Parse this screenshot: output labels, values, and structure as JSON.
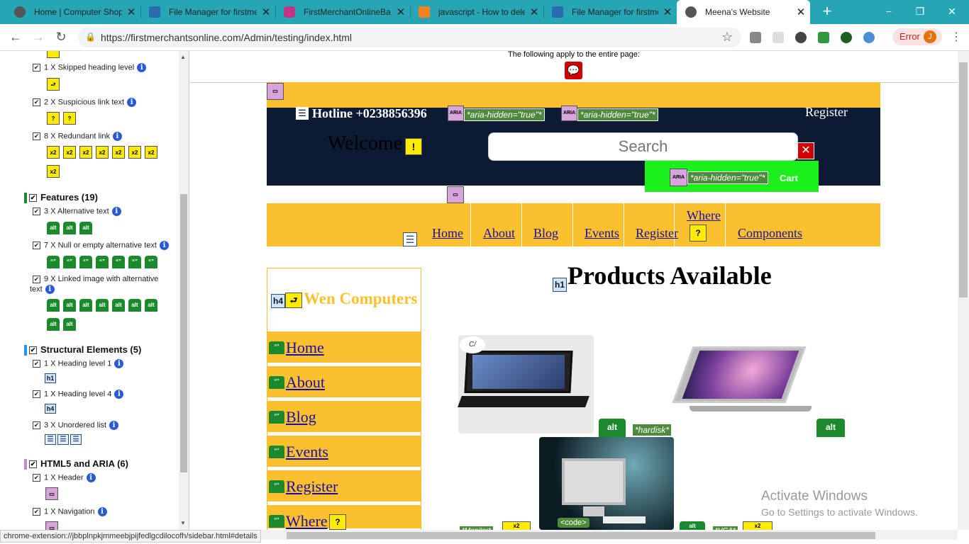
{
  "browser": {
    "tabs": [
      {
        "title": "Home | Computer Shop",
        "color": "#555"
      },
      {
        "title": "File Manager for firstme",
        "color": "#2b6cb0"
      },
      {
        "title": "FirstMerchantOnlineBa",
        "color": "#c13584"
      },
      {
        "title": "javascript - How to dele",
        "color": "#f48024"
      },
      {
        "title": "File Manager for firstme",
        "color": "#2b6cb0"
      },
      {
        "title": "Meena's Website",
        "color": "#555"
      }
    ],
    "new_tab": "+",
    "window_controls": [
      "−",
      "❐",
      "✕"
    ],
    "url": "https://firstmerchantsonline.com/Admin/testing/index.html",
    "error_label": "Error",
    "avatar_letter": "J",
    "status_url": "chrome-extension://jbbplnpkjmmeebjpijfedlgcdilocofh/sidebar.html#details"
  },
  "sidebar": {
    "items_top": [
      {
        "label": "1 X Skipped heading level"
      },
      {
        "label": "2 X Suspicious link text"
      },
      {
        "label": "8 X Redundant link"
      }
    ],
    "sections": [
      {
        "title": "Features (19)",
        "color": "#1a8a2c"
      },
      {
        "title": "Structural Elements (5)",
        "color": "#2196f3"
      },
      {
        "title": "HTML5 and ARIA (6)",
        "color": "#c48ad0"
      }
    ],
    "features": [
      {
        "label": "3 X Alternative text"
      },
      {
        "label": "7 X Null or empty alternative text"
      },
      {
        "label": "9 X Linked image with alternative"
      },
      {
        "label": "text"
      }
    ],
    "structural": [
      {
        "label": "1 X Heading level 1",
        "badge": "h1"
      },
      {
        "label": "1 X Heading level 4",
        "badge": "h4"
      },
      {
        "label": "3 X Unordered list"
      }
    ],
    "html5": [
      {
        "label": "1 X Header"
      },
      {
        "label": "1 X Navigation"
      }
    ],
    "icon_alt": "alt",
    "icon_quote": "“”",
    "icon_x2": "x2"
  },
  "page": {
    "notice": "The following apply to the entire page:",
    "hotline": "Hotline +0238856396",
    "aria_label": "ARIA",
    "aria_hidden": "*aria-hidden=\"true\"*",
    "register_top": "Register",
    "welcome": "Welcome",
    "search_placeholder": "Search",
    "cart": "Cart",
    "nav": [
      "Home",
      "About",
      "Blog",
      "Events",
      "Register",
      "Where",
      "Components"
    ],
    "brand_badge": "h4",
    "brand": "Wen Computers",
    "h1_badge": "h1",
    "heading": "Products Available",
    "left_nav": [
      "Home",
      "About",
      "Blog",
      "Events",
      "Register",
      "Where"
    ],
    "hardisk_tag": "*hardisk*",
    "code_tag": "<code>",
    "monitor_tag": "*Monitor*",
    "vga_tag": "*VGA*",
    "watermark_title": "Activate Windows",
    "watermark_sub": "Go to Settings to activate Windows."
  }
}
